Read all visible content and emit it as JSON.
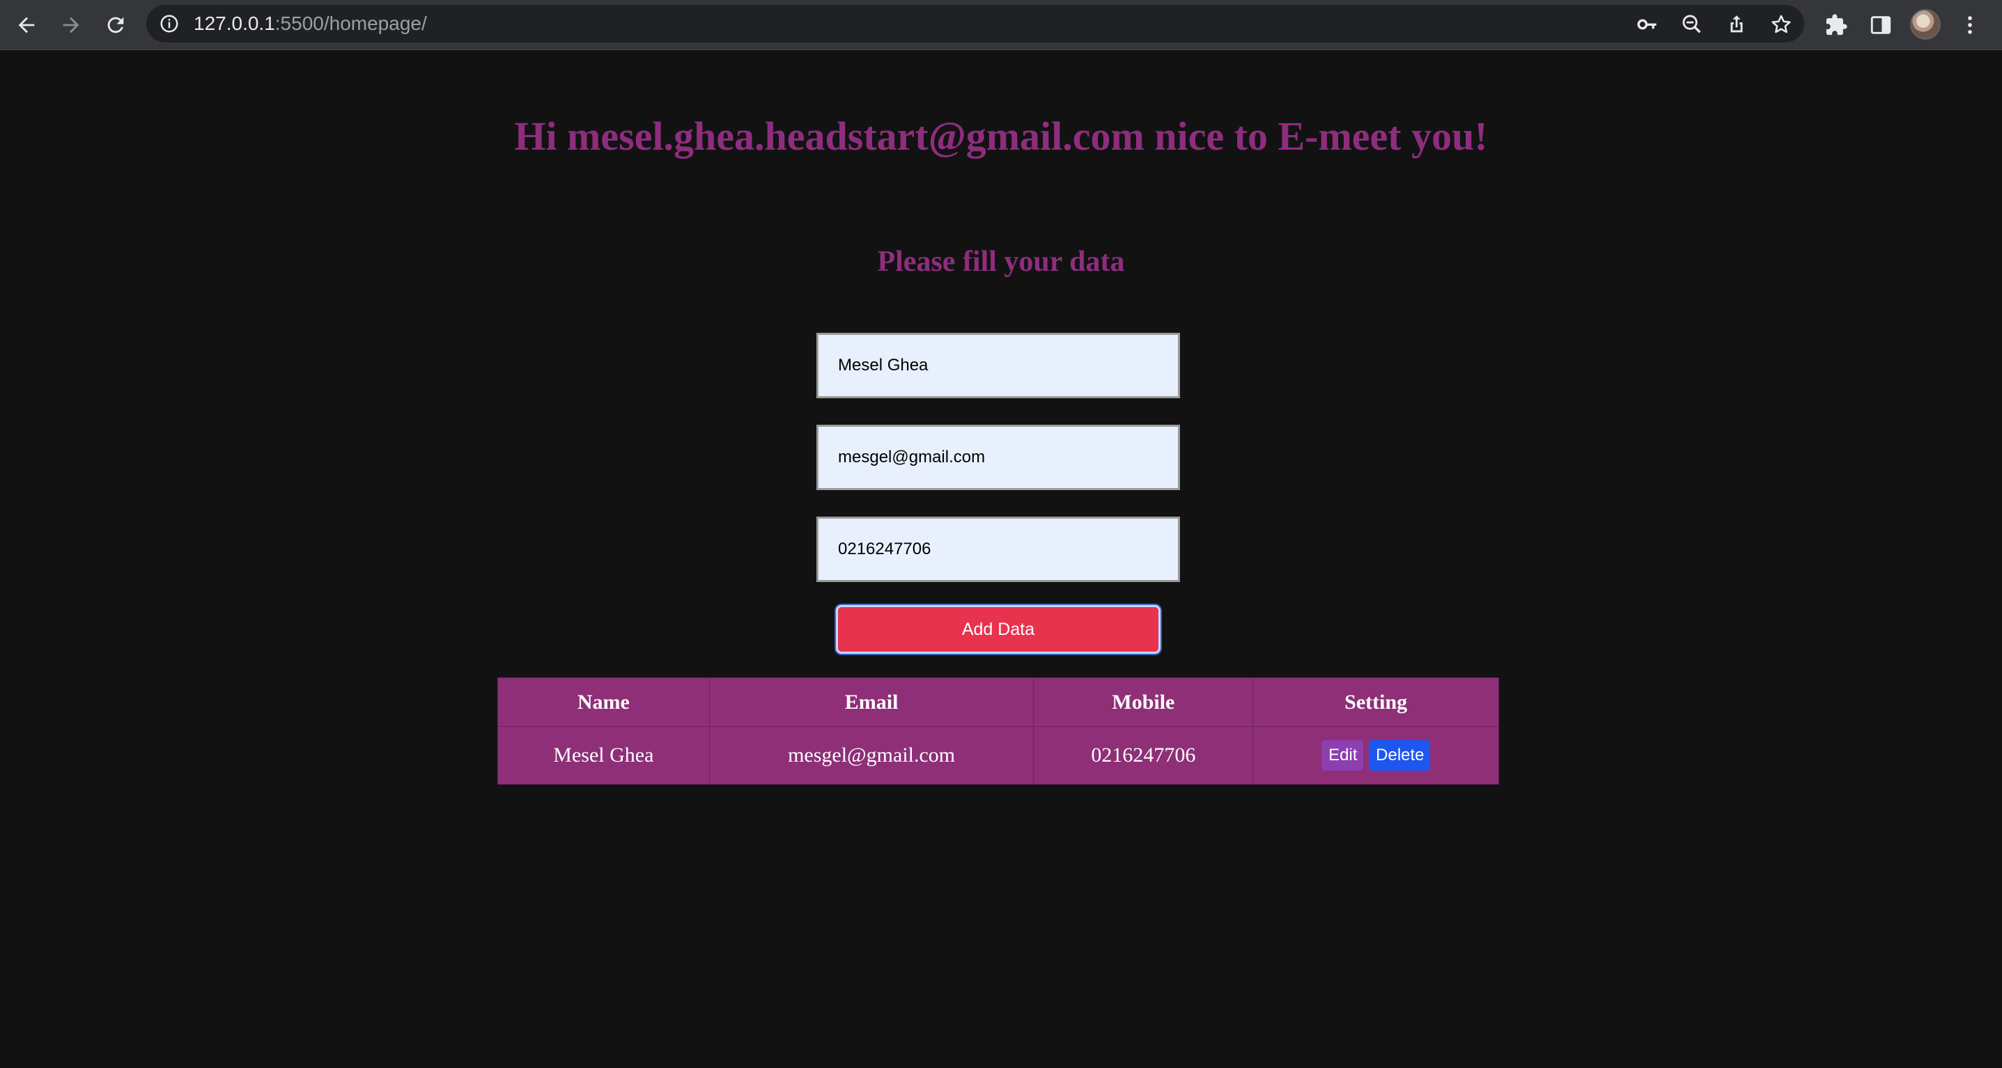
{
  "browser": {
    "url_host": "127.0.0.1",
    "url_rest": ":5500/homepage/"
  },
  "page": {
    "greeting": "Hi mesel.ghea.headstart@gmail.com nice to E-meet you!",
    "subtitle": "Please fill your data",
    "form": {
      "name_value": "Mesel Ghea",
      "email_value": "mesgel@gmail.com",
      "mobile_value": "0216247706",
      "submit_label": "Add Data"
    },
    "table": {
      "headers": [
        "Name",
        "Email",
        "Mobile",
        "Setting"
      ],
      "rows": [
        {
          "name": "Mesel Ghea",
          "email": "mesgel@gmail.com",
          "mobile": "0216247706",
          "edit_label": "Edit",
          "delete_label": "Delete"
        }
      ]
    }
  },
  "colors": {
    "heading": "#8e2d7d",
    "table_bg": "#8e2f78",
    "add_button": "#e8334f",
    "edit_button": "#8d3fb0",
    "delete_button": "#1e56f0",
    "background": "#121213"
  },
  "icons": [
    "back-icon",
    "forward-icon",
    "reload-icon",
    "info-icon",
    "key-icon",
    "zoom-out-icon",
    "share-icon",
    "star-icon",
    "extensions-icon",
    "side-panel-icon",
    "avatar",
    "menu-icon"
  ]
}
